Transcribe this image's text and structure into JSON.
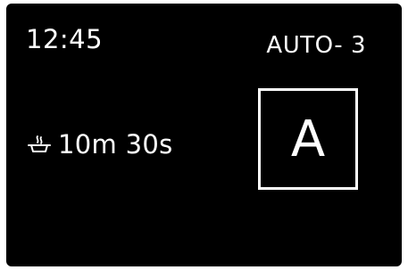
{
  "display": {
    "time": "12:45",
    "mode_label": "AUTO- 3",
    "timer_icon": "cooking-pot-icon",
    "timer": "10m 30s",
    "mode_letter": "A",
    "colors": {
      "background": "#000000",
      "foreground": "#ffffff"
    }
  }
}
